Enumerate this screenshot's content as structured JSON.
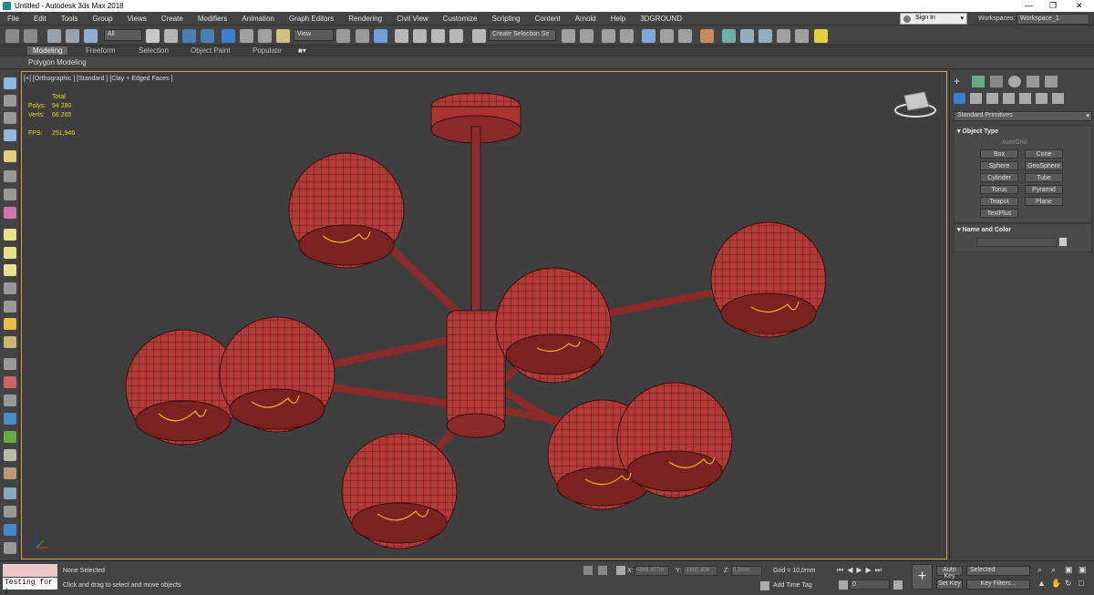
{
  "window": {
    "title": "Untitled - Autodesk 3ds Max 2018"
  },
  "menu": [
    "File",
    "Edit",
    "Tools",
    "Group",
    "Views",
    "Create",
    "Modifiers",
    "Animation",
    "Graph Editors",
    "Rendering",
    "Civil View",
    "Customize",
    "Scripting",
    "Content",
    "Arnold",
    "Help",
    "3DGROUND"
  ],
  "account": {
    "signin": "Sign In",
    "workspaces_label": "Workspaces:",
    "workspace": "Workspace_1"
  },
  "toolbar": {
    "filter": "All",
    "refcoord": "View",
    "selection_set": "Create Selection Se"
  },
  "ribbon": {
    "tabs": [
      "Modeling",
      "Freeform",
      "Selection",
      "Object Paint",
      "Populate"
    ],
    "active": "Modeling",
    "sub": "Polygon Modeling"
  },
  "viewport": {
    "label": "[+] [Orthographic ] [Standard ] [Clay + Edged Faces ]",
    "stats": {
      "total_label": "Total",
      "polys_label": "Polys:",
      "polys": "94 280",
      "verts_label": "Verts:",
      "verts": "66 265",
      "fps_label": "FPS:",
      "fps": "251,946"
    }
  },
  "command_panel": {
    "dropdown": "Standard Primitives",
    "object_type": "Object Type",
    "autogrid": "AutoGrid",
    "buttons": [
      "Box",
      "Cone",
      "Sphere",
      "GeoSphere",
      "Cylinder",
      "Tube",
      "Torus",
      "Pyramid",
      "Teapot",
      "Plane",
      "TextPlus"
    ],
    "name_color": "Name and Color"
  },
  "status": {
    "script_field": "Testing for ;",
    "selected": "None Selected",
    "prompt": "Click and drag to select and move objects",
    "x_label": "X:",
    "x_value": "4368,407m",
    "y_label": "Y:",
    "y_value": "-1600,404",
    "z_label": "Z:",
    "z_value": "0,0mm",
    "grid": "Grid = 10,0mm",
    "add_time_tag": "Add Time Tag",
    "frame": "0",
    "autokey": "Auto Key",
    "setkey": "Set Key",
    "selected_dd": "Selected",
    "key_filters": "Key Filters..."
  }
}
